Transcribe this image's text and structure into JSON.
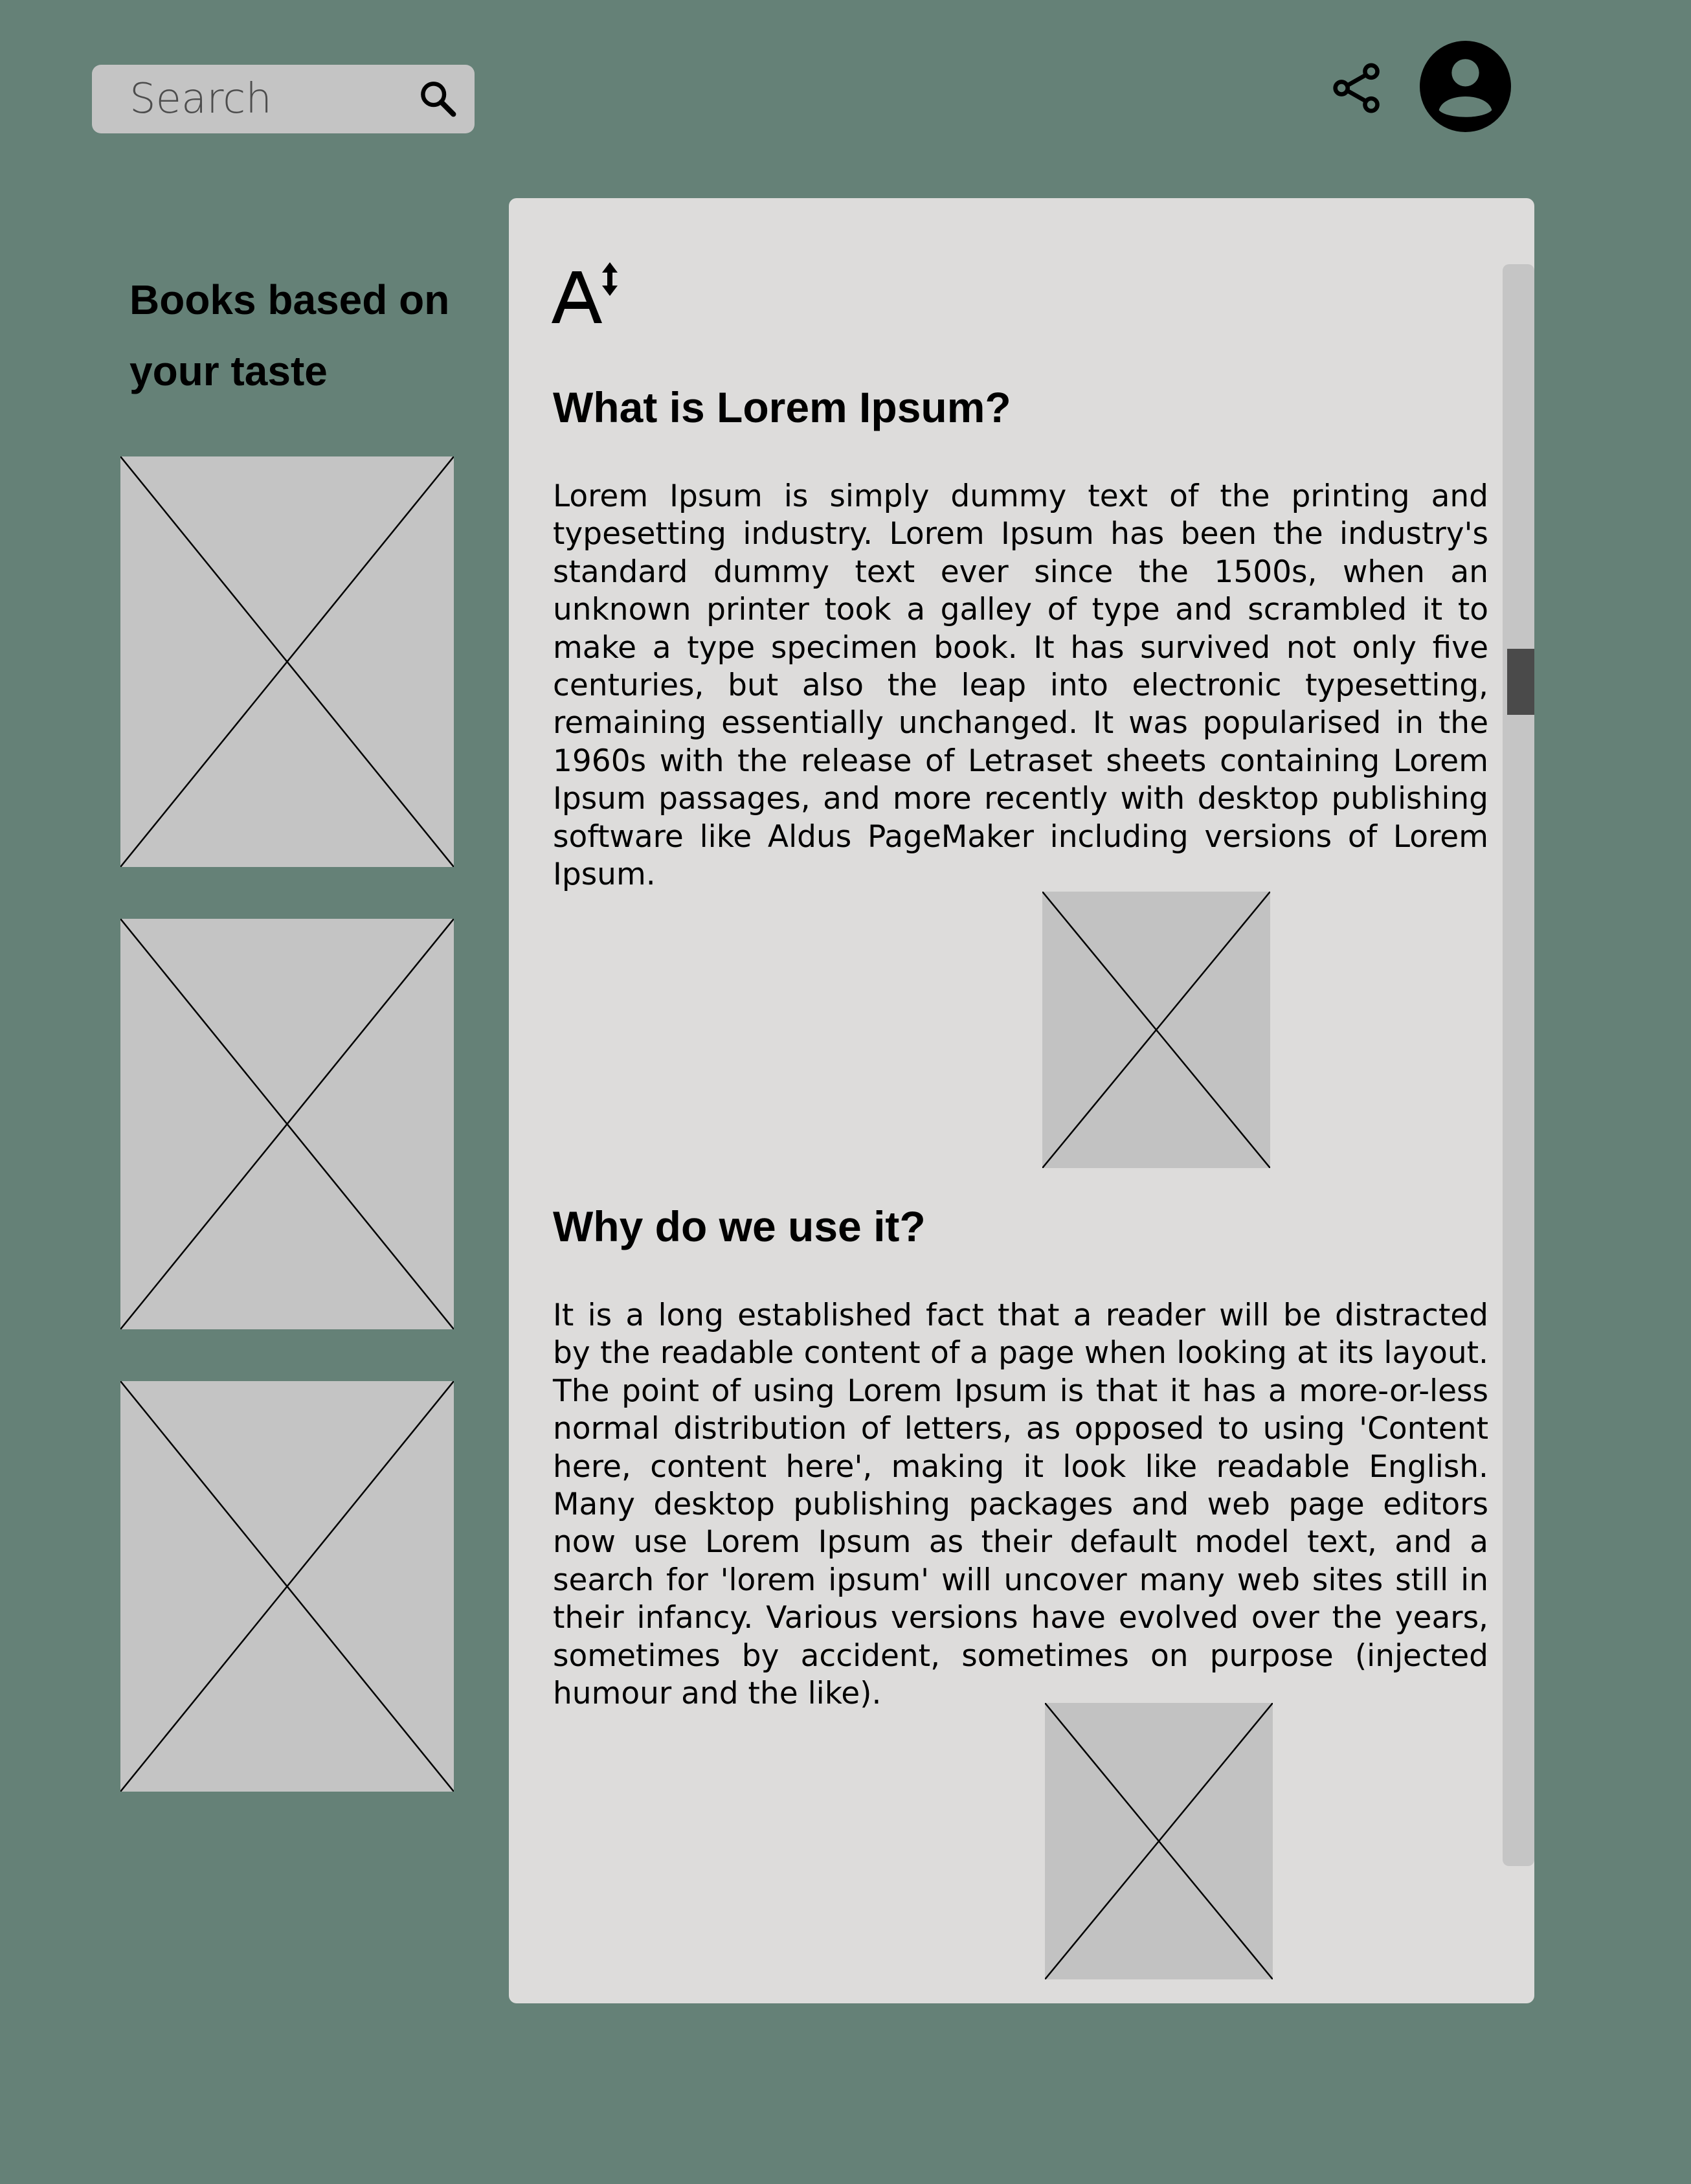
{
  "header": {
    "search": {
      "placeholder": "Search",
      "value": ""
    },
    "share_icon": "share-icon",
    "avatar_icon": "account-circle-icon"
  },
  "sidebar": {
    "title": "Books based on your taste",
    "recommendations": [
      {
        "image": "book-cover-placeholder"
      },
      {
        "image": "book-cover-placeholder"
      },
      {
        "image": "book-cover-placeholder"
      }
    ]
  },
  "article": {
    "text_size_icon": "text-size-icon",
    "sections": [
      {
        "heading": "What is Lorem Ipsum?",
        "body": "Lorem Ipsum is simply dummy text of the printing and typesetting industry. Lorem Ipsum has been the industry's standard dummy text ever since the 1500s, when an unknown printer took a galley of type and scrambled it to make a type specimen book. It has survived not only five centuries, but also the leap into electronic typesetting, remaining essentially unchanged. It was popularised in the 1960s with the release of Letraset sheets containing Lorem Ipsum passages, and more recently with desktop publishing software like Aldus PageMaker including versions of Lorem Ipsum."
      },
      {
        "heading": "Why do we use it?",
        "body": "It is a long established fact that a reader will be distracted by the readable content of a page when looking at its layout. The point of using Lorem Ipsum is that it has a more-or-less normal distribution of letters, as opposed to using 'Content here, content here', making it look like readable English. Many desktop publishing packages and web page editors now use Lorem Ipsum as their default model text, and a search for 'lorem ipsum' will uncover many web sites still in their infancy. Various versions have evolved over the years, sometimes by accident, sometimes on purpose (injected humour and the like)."
      }
    ],
    "scroll_position": 0.27
  },
  "colors": {
    "background": "#658177",
    "panel": "#dddcdb",
    "placeholder": "#c4c4c4",
    "scroll_thumb": "#4a4a4a"
  }
}
